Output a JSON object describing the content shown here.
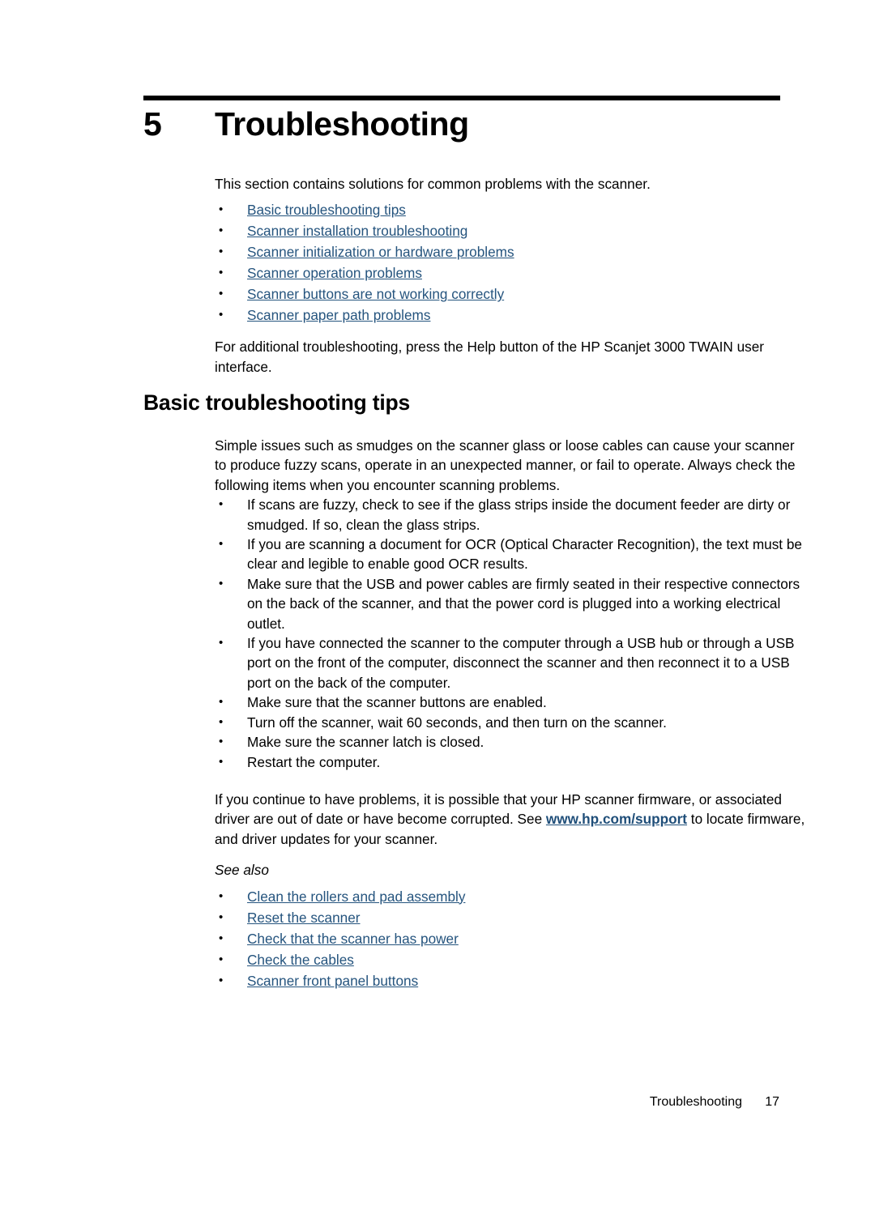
{
  "chapter": {
    "number": "5",
    "title": "Troubleshooting"
  },
  "intro": {
    "paragraph": "This section contains solutions for common problems with the scanner.",
    "links": [
      "Basic troubleshooting tips",
      "Scanner installation troubleshooting",
      "Scanner initialization or hardware problems",
      "Scanner operation problems",
      "Scanner buttons are not working correctly",
      "Scanner paper path problems"
    ],
    "closing": "For additional troubleshooting, press the Help button of the HP Scanjet 3000 TWAIN user interface."
  },
  "section": {
    "heading": "Basic troubleshooting tips",
    "intro": "Simple issues such as smudges on the scanner glass or loose cables can cause your scanner to produce fuzzy scans, operate in an unexpected manner, or fail to operate. Always check the following items when you encounter scanning problems.",
    "bullets": [
      "If scans are fuzzy, check to see if the glass strips inside the document feeder are dirty or smudged. If so, clean the glass strips.",
      "If you are scanning a document for OCR (Optical Character Recognition), the text must be clear and legible to enable good OCR results.",
      "Make sure that the USB and power cables are firmly seated in their respective connectors on the back of the scanner, and that the power cord is plugged into a working electrical outlet.",
      "If you have connected the scanner to the computer through a USB hub or through a USB port on the front of the computer, disconnect the scanner and then reconnect it to a USB port on the back of the computer.",
      "Make sure that the scanner buttons are enabled.",
      "Turn off the scanner, wait 60 seconds, and then turn on the scanner.",
      "Make sure the scanner latch is closed.",
      "Restart the computer."
    ],
    "firmware_note": {
      "before": "If you continue to have problems, it is possible that your HP scanner firmware, or associated driver are out of date or have become corrupted. See ",
      "url_text": "www.hp.com/support",
      "after": " to locate firmware, and driver updates for your scanner."
    },
    "see_also_label": "See also",
    "see_also_links": [
      "Clean the rollers and pad assembly",
      "Reset the scanner",
      "Check that the scanner has power",
      "Check the cables",
      "Scanner front panel buttons"
    ]
  },
  "footer": {
    "label": "Troubleshooting",
    "page_number": "17"
  },
  "colors": {
    "link": "#25547E",
    "url_link": "#1F4E79",
    "text": "#000000",
    "background": "#ffffff"
  }
}
